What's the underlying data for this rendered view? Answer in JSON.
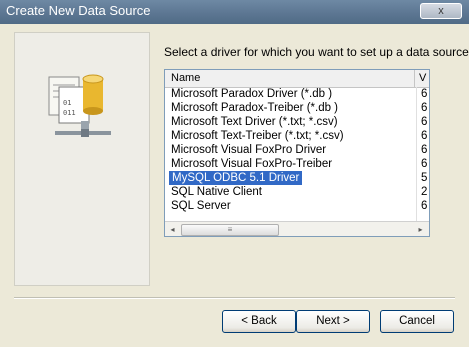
{
  "window": {
    "title": "Create New Data Source",
    "close_label": "x"
  },
  "prompt": "Select a driver for which you want to set up a data source.",
  "list": {
    "columns": {
      "name": "Name",
      "version": "V"
    },
    "rows": [
      {
        "name": "Microsoft Paradox Driver (*.db )",
        "version": "6"
      },
      {
        "name": "Microsoft Paradox-Treiber (*.db )",
        "version": "6"
      },
      {
        "name": "Microsoft Text Driver (*.txt; *.csv)",
        "version": "6"
      },
      {
        "name": "Microsoft Text-Treiber (*.txt; *.csv)",
        "version": "6"
      },
      {
        "name": "Microsoft Visual FoxPro Driver",
        "version": "6"
      },
      {
        "name": "Microsoft Visual FoxPro-Treiber",
        "version": "6"
      },
      {
        "name": "MySQL ODBC 5.1 Driver",
        "version": "5",
        "selected": true
      },
      {
        "name": "SQL Native Client",
        "version": "2"
      },
      {
        "name": "SQL Server",
        "version": "6"
      }
    ],
    "scroll_left": "◂",
    "scroll_right": "▸",
    "scroll_grip": "≡"
  },
  "buttons": {
    "back": "< Back",
    "next": "Next >",
    "cancel": "Cancel"
  },
  "colors": {
    "selection": "#3169c6",
    "titlebar": "#5b7591",
    "dialog_bg": "#ece9d8"
  },
  "icons": {
    "wizard": "database-network-icon"
  }
}
